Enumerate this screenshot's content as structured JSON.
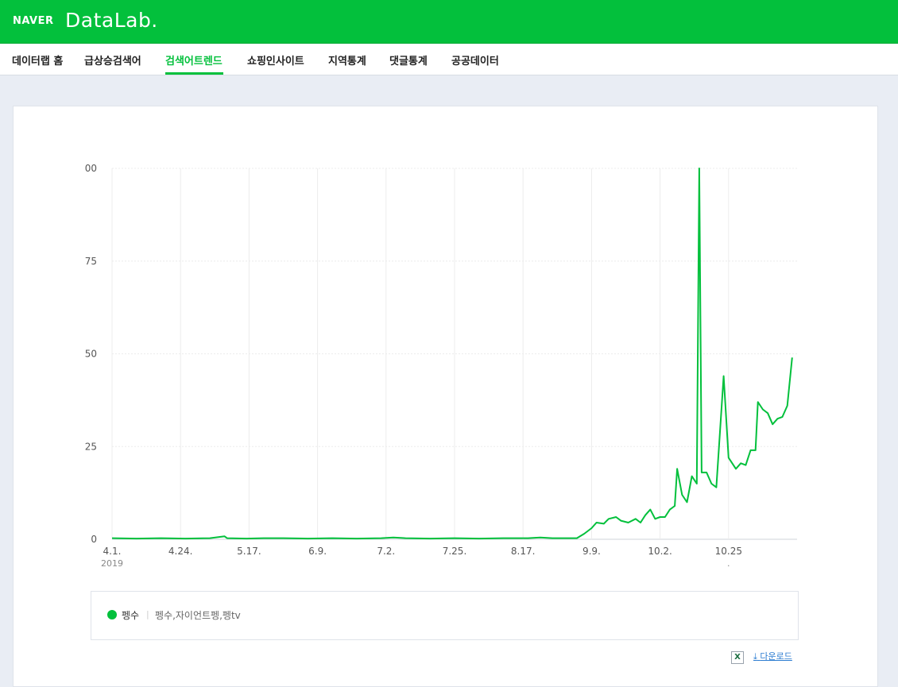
{
  "header": {
    "logo_naver": "NAVER",
    "logo_datalab": "DataLab."
  },
  "nav": {
    "items": [
      {
        "label": "데이터랩 홈"
      },
      {
        "label": "급상승검색어"
      },
      {
        "label": "검색어트렌드",
        "active": true
      },
      {
        "label": "쇼핑인사이트"
      },
      {
        "label": "지역통계"
      },
      {
        "label": "댓글통계"
      },
      {
        "label": "공공데이터"
      }
    ]
  },
  "colors": {
    "brand": "#03c03c",
    "series": "#03c03c",
    "link": "#2c7cd1"
  },
  "legend": {
    "name": "펭수",
    "separator": "|",
    "keywords": "펭수,자이언트펭,펭tv"
  },
  "download": {
    "label": "다운로드",
    "excel_icon": "excel-icon",
    "download_icon": "download-arrow-icon"
  },
  "chart_data": {
    "type": "line",
    "title": "",
    "xlabel": "",
    "ylabel": "",
    "ylim": [
      0,
      100
    ],
    "grid": true,
    "y_ticks": [
      "00",
      "75",
      "50",
      "25",
      "0"
    ],
    "x_ticks": [
      "4.1.",
      "4.24.",
      "5.17.",
      "6.9.",
      "7.2.",
      "7.25.",
      "8.17.",
      "9.9.",
      "10.2.",
      "10.25"
    ],
    "x_year_label": "2019",
    "x_end_mark": ".",
    "series": [
      {
        "name": "펭수",
        "color": "#03c03c",
        "points": [
          [
            0,
            0.3
          ],
          [
            10,
            0.2
          ],
          [
            20,
            0.3
          ],
          [
            30,
            0.2
          ],
          [
            40,
            0.3
          ],
          [
            46,
            0.8
          ],
          [
            47,
            0.3
          ],
          [
            55,
            0.2
          ],
          [
            62,
            0.3
          ],
          [
            70,
            0.3
          ],
          [
            80,
            0.2
          ],
          [
            90,
            0.3
          ],
          [
            100,
            0.2
          ],
          [
            110,
            0.3
          ],
          [
            115,
            0.5
          ],
          [
            120,
            0.3
          ],
          [
            130,
            0.2
          ],
          [
            140,
            0.3
          ],
          [
            150,
            0.2
          ],
          [
            160,
            0.3
          ],
          [
            170,
            0.3
          ],
          [
            175,
            0.5
          ],
          [
            180,
            0.3
          ],
          [
            186,
            0.3
          ],
          [
            190,
            0.3
          ],
          [
            193,
            1.5
          ],
          [
            196,
            3
          ],
          [
            198,
            4.5
          ],
          [
            201,
            4.2
          ],
          [
            203,
            5.5
          ],
          [
            206,
            6.0
          ],
          [
            208,
            5.0
          ],
          [
            211,
            4.5
          ],
          [
            214,
            5.5
          ],
          [
            216,
            4.5
          ],
          [
            218,
            6.5
          ],
          [
            220,
            8
          ],
          [
            222,
            5.5
          ],
          [
            224,
            6
          ],
          [
            226,
            6
          ],
          [
            228,
            8
          ],
          [
            230,
            9
          ],
          [
            231,
            19
          ],
          [
            233,
            12
          ],
          [
            235,
            10
          ],
          [
            237,
            17
          ],
          [
            239,
            15
          ],
          [
            240,
            100
          ],
          [
            241,
            18
          ],
          [
            243,
            18
          ],
          [
            245,
            15
          ],
          [
            247,
            14
          ],
          [
            250,
            44
          ],
          [
            252,
            22
          ],
          [
            255,
            19
          ],
          [
            257,
            20.5
          ],
          [
            259,
            20
          ],
          [
            261,
            24
          ],
          [
            263,
            24
          ],
          [
            264,
            37
          ],
          [
            266,
            35
          ],
          [
            268,
            34
          ],
          [
            270,
            31
          ],
          [
            272,
            32.5
          ],
          [
            274,
            33
          ],
          [
            276,
            36
          ],
          [
            278,
            49
          ]
        ]
      }
    ]
  }
}
